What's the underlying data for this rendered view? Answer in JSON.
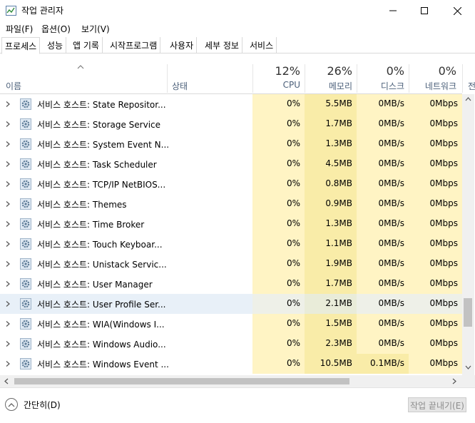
{
  "window": {
    "title": "작업 관리자"
  },
  "menu": [
    "파일(F)",
    "옵션(O)",
    "보기(V)"
  ],
  "tabs": [
    "프로세스",
    "성능",
    "앱 기록",
    "시작프로그램",
    "사용자",
    "세부 정보",
    "서비스"
  ],
  "columns": {
    "name": "이름",
    "status": "상태",
    "cpu": {
      "percent": "12%",
      "label": "CPU"
    },
    "memory": {
      "percent": "26%",
      "label": "메모리"
    },
    "disk": {
      "percent": "0%",
      "label": "디스크"
    },
    "network": {
      "percent": "0%",
      "label": "네트워크"
    },
    "extra": "전"
  },
  "rows": [
    {
      "name": "서비스 호스트: State Repositor...",
      "cpu": "0%",
      "memory": "5.5MB",
      "disk": "0MB/s",
      "network": "0Mbps"
    },
    {
      "name": "서비스 호스트: Storage Service",
      "cpu": "0%",
      "memory": "1.7MB",
      "disk": "0MB/s",
      "network": "0Mbps"
    },
    {
      "name": "서비스 호스트: System Event N...",
      "cpu": "0%",
      "memory": "1.3MB",
      "disk": "0MB/s",
      "network": "0Mbps"
    },
    {
      "name": "서비스 호스트: Task Scheduler",
      "cpu": "0%",
      "memory": "4.5MB",
      "disk": "0MB/s",
      "network": "0Mbps"
    },
    {
      "name": "서비스 호스트: TCP/IP NetBIOS...",
      "cpu": "0%",
      "memory": "0.8MB",
      "disk": "0MB/s",
      "network": "0Mbps"
    },
    {
      "name": "서비스 호스트: Themes",
      "cpu": "0%",
      "memory": "0.9MB",
      "disk": "0MB/s",
      "network": "0Mbps"
    },
    {
      "name": "서비스 호스트: Time Broker",
      "cpu": "0%",
      "memory": "1.3MB",
      "disk": "0MB/s",
      "network": "0Mbps"
    },
    {
      "name": "서비스 호스트: Touch Keyboar...",
      "cpu": "0%",
      "memory": "1.1MB",
      "disk": "0MB/s",
      "network": "0Mbps"
    },
    {
      "name": "서비스 호스트: Unistack Servic...",
      "cpu": "0%",
      "memory": "1.9MB",
      "disk": "0MB/s",
      "network": "0Mbps"
    },
    {
      "name": "서비스 호스트: User Manager",
      "cpu": "0%",
      "memory": "1.7MB",
      "disk": "0MB/s",
      "network": "0Mbps"
    },
    {
      "name": "서비스 호스트: User Profile Ser...",
      "cpu": "0%",
      "memory": "2.1MB",
      "disk": "0MB/s",
      "network": "0Mbps"
    },
    {
      "name": "서비스 호스트: WIA(Windows I...",
      "cpu": "0%",
      "memory": "1.5MB",
      "disk": "0MB/s",
      "network": "0Mbps"
    },
    {
      "name": "서비스 호스트: Windows Audio...",
      "cpu": "0%",
      "memory": "2.3MB",
      "disk": "0MB/s",
      "network": "0Mbps"
    },
    {
      "name": "서비스 호스트: Windows Event ...",
      "cpu": "0%",
      "memory": "10.5MB",
      "disk": "0.1MB/s",
      "network": "0Mbps"
    }
  ],
  "footer": {
    "fewer_details": "간단히(D)",
    "end_task": "작업 끝내기(E)"
  },
  "icons": {
    "service": "gear-icon",
    "expand": "chevron-right-icon"
  },
  "colors": {
    "heat_light": "#fff4c4",
    "heat_medium": "#f9eca8",
    "selection": "#e8f0f8"
  }
}
